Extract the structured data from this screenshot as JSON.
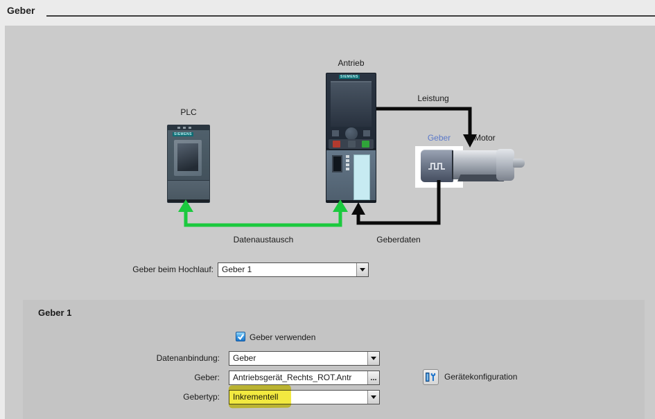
{
  "page": {
    "title": "Geber"
  },
  "brand": "SIEMENS",
  "diagram": {
    "labels": {
      "plc": "PLC",
      "antrieb": "Antrieb",
      "leistung": "Leistung",
      "motor": "Motor",
      "geber": "Geber",
      "datenaustausch": "Datenaustausch",
      "geberdaten": "Geberdaten"
    },
    "colors": {
      "data_exchange_green": "#1bc93e",
      "connection_black": "#0a0a0a",
      "geber_label_blue": "#5b79c9",
      "highlight_yellow": "#f0e51e"
    }
  },
  "startup_row": {
    "label": "Geber beim Hochlauf:",
    "value": "Geber 1"
  },
  "geber1": {
    "title": "Geber 1",
    "checkbox_label": "Geber verwenden",
    "checkbox_checked": true,
    "datenanbindung": {
      "label": "Datenanbindung:",
      "value": "Geber"
    },
    "geber_ref": {
      "label": "Geber:",
      "value": "Antriebsgerät_Rechts_ROT.Antr",
      "browse_label": "..."
    },
    "gebertyp": {
      "label": "Gebertyp:",
      "value": "Inkrementell",
      "highlighted": true
    },
    "device_config": {
      "label": "Gerätekonfiguration"
    }
  }
}
